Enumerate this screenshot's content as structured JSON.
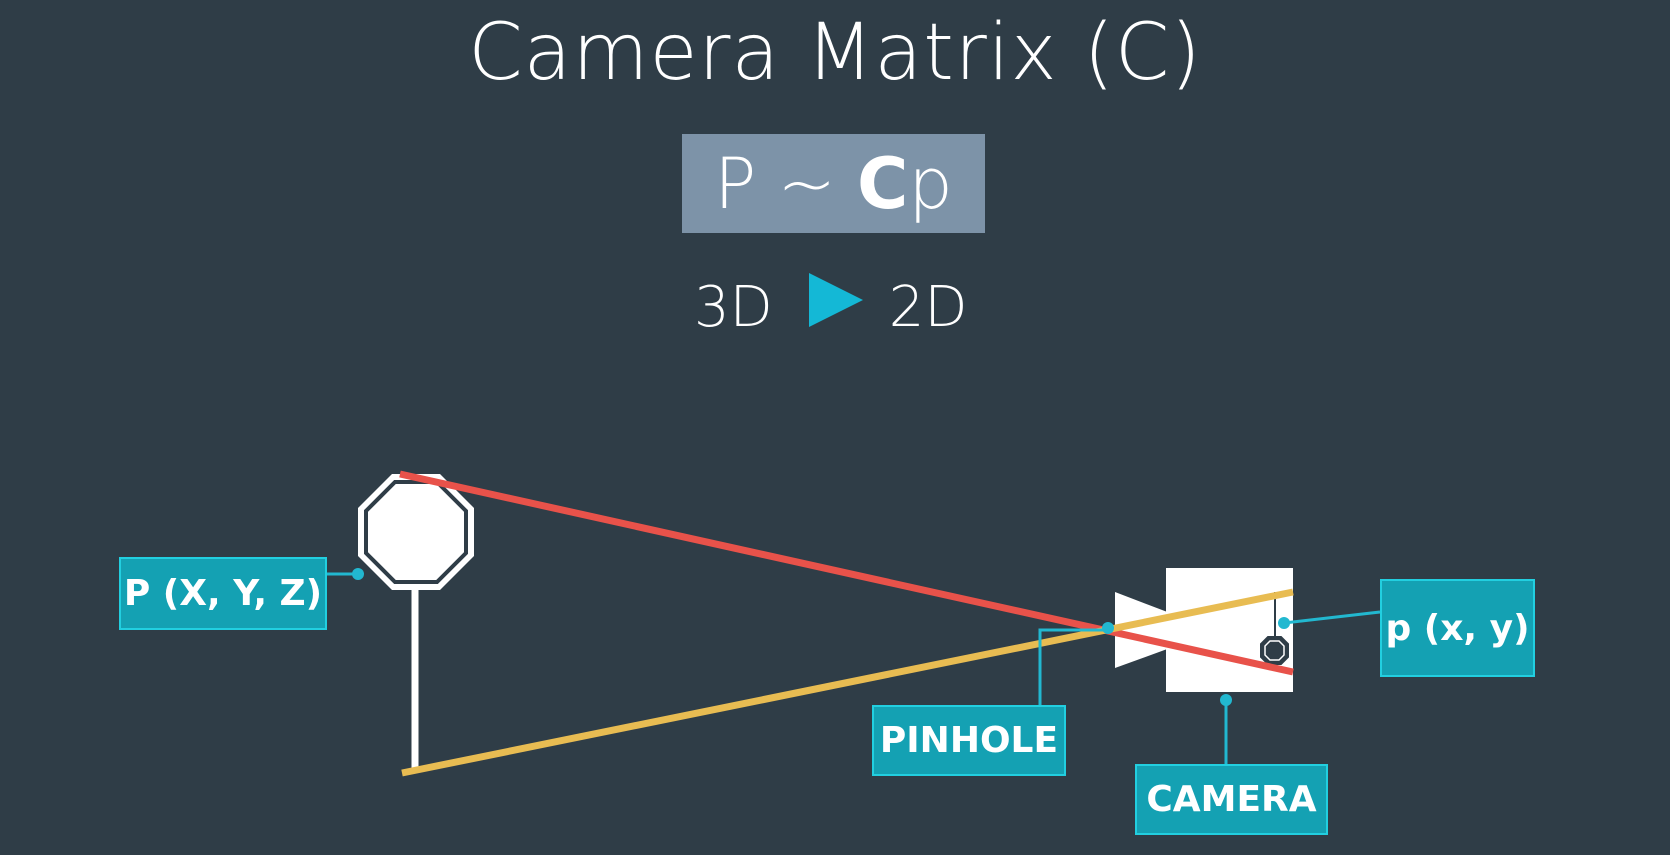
{
  "title": "Camera Matrix (C)",
  "formula": {
    "lhs": "P",
    "op": "~",
    "matrix": "C",
    "rhs": "p"
  },
  "mapping": {
    "from": "3D",
    "to": "2D",
    "arrow_icon": "play-triangle-icon"
  },
  "labels": {
    "world_point": "P (X, Y, Z)",
    "image_point": "p (x, y)",
    "pinhole": "PINHOLE",
    "camera": "CAMERA"
  },
  "colors": {
    "background": "#2f3d47",
    "accent": "#14a1b3",
    "accent_border": "#22cfe0",
    "ray_top": "#e8524a",
    "ray_bottom": "#e8bc52",
    "formula_box": "#7d93a8",
    "arrow": "#14b8d6"
  }
}
